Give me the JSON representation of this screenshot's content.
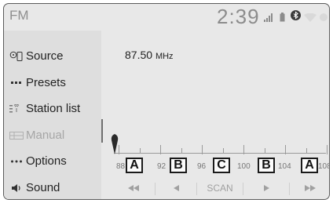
{
  "status_bar": {
    "mode": "FM",
    "time": "2:39"
  },
  "sidebar": {
    "items": [
      {
        "label": "Source",
        "icon": "source-icon",
        "state": "normal"
      },
      {
        "label": "Presets",
        "icon": "presets-icon",
        "state": "normal"
      },
      {
        "label": "Station list",
        "icon": "station-list-icon",
        "state": "normal"
      },
      {
        "label": "Manual",
        "icon": "manual-icon",
        "state": "disabled"
      },
      {
        "label": "Options",
        "icon": "options-icon",
        "state": "normal"
      },
      {
        "label": "Sound",
        "icon": "sound-icon",
        "state": "normal"
      }
    ]
  },
  "tuner": {
    "frequency": "87.50",
    "unit": "MHz",
    "scale_labels": [
      "88",
      "92",
      "96",
      "100",
      "104",
      "108"
    ],
    "presets": [
      "A",
      "B",
      "C",
      "B",
      "A"
    ]
  },
  "controls": {
    "scan_label": "SCAN"
  },
  "colors": {
    "background": "#e8e8e8",
    "sidebar": "#dedede",
    "text": "#222222",
    "disabled": "#a6a6a6"
  }
}
